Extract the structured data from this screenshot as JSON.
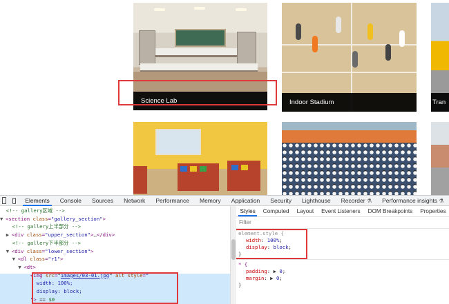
{
  "gallery": {
    "cards": [
      {
        "name": "science-lab-card",
        "caption": "Science Lab"
      },
      {
        "name": "indoor-stadium-card",
        "caption": "Indoor Stadium"
      },
      {
        "name": "transport-card",
        "caption": "Tran"
      }
    ]
  },
  "devtools": {
    "tabs": [
      "Elements",
      "Console",
      "Sources",
      "Network",
      "Performance",
      "Memory",
      "Application",
      "Security",
      "Lighthouse",
      "Recorder",
      "Performance insights"
    ],
    "active_tab": "Elements",
    "flask_icon": "flask-icon",
    "elements": {
      "lines": [
        {
          "indent": "  ",
          "parts": [
            {
              "c": "cmt",
              "t": "<!-- gallery区域 -->"
            }
          ]
        },
        {
          "indent": "",
          "tri": "▼",
          "parts": [
            {
              "c": "tag",
              "t": "<section "
            },
            {
              "c": "attr",
              "t": "class"
            },
            {
              "c": "tag",
              "t": "="
            },
            {
              "c": "val",
              "t": "\"gallery_section\""
            },
            {
              "c": "tag",
              "t": ">"
            }
          ]
        },
        {
          "indent": "    ",
          "parts": [
            {
              "c": "cmt",
              "t": "<!-- gallery上半部分 -->"
            }
          ]
        },
        {
          "indent": "  ",
          "tri": "▶",
          "parts": [
            {
              "c": "tag",
              "t": "<div "
            },
            {
              "c": "attr",
              "t": "class"
            },
            {
              "c": "tag",
              "t": "="
            },
            {
              "c": "val",
              "t": "\"upper_section\""
            },
            {
              "c": "tag",
              "t": ">"
            },
            {
              "c": "plain",
              "t": "…"
            },
            {
              "c": "tag",
              "t": "</div>"
            }
          ]
        },
        {
          "indent": "    ",
          "parts": [
            {
              "c": "cmt",
              "t": "<!-- gallery下半部分 -->"
            }
          ]
        },
        {
          "indent": "  ",
          "tri": "▼",
          "parts": [
            {
              "c": "tag",
              "t": "<div "
            },
            {
              "c": "attr",
              "t": "class"
            },
            {
              "c": "tag",
              "t": "="
            },
            {
              "c": "val",
              "t": "\"lower_section\""
            },
            {
              "c": "tag",
              "t": ">"
            }
          ]
        },
        {
          "indent": "    ",
          "tri": "▼",
          "parts": [
            {
              "c": "tag",
              "t": "<dl "
            },
            {
              "c": "attr",
              "t": "class"
            },
            {
              "c": "tag",
              "t": "="
            },
            {
              "c": "val",
              "t": "\"r1\""
            },
            {
              "c": "tag",
              "t": ">"
            }
          ]
        },
        {
          "indent": "      ",
          "tri": "▼",
          "parts": [
            {
              "c": "tag",
              "t": "<dt>"
            }
          ]
        },
        {
          "indent": "          ",
          "parts": [
            {
              "c": "tag",
              "t": "<img "
            },
            {
              "c": "attr",
              "t": "src"
            },
            {
              "c": "tag",
              "t": "="
            },
            {
              "c": "plain",
              "t": "\""
            },
            {
              "c": "link",
              "t": "images/03-01.jpg"
            },
            {
              "c": "plain",
              "t": "\" "
            },
            {
              "c": "attr",
              "t": "alt style"
            },
            {
              "c": "tag",
              "t": "="
            },
            {
              "c": "val",
              "t": "\""
            }
          ]
        },
        {
          "indent": "            ",
          "parts": [
            {
              "c": "val",
              "t": "width: 100%;"
            }
          ]
        },
        {
          "indent": "            ",
          "parts": [
            {
              "c": "val",
              "t": "display: block;"
            }
          ]
        },
        {
          "indent": "          ",
          "parts": [
            {
              "c": "val",
              "t": "\""
            },
            {
              "c": "tag",
              "t": ">"
            },
            {
              "c": "plain",
              "t": " == "
            },
            {
              "c": "cmt",
              "t": "$0"
            }
          ]
        }
      ]
    },
    "styles": {
      "subtabs": [
        "Styles",
        "Computed",
        "Layout",
        "Event Listeners",
        "DOM Breakpoints",
        "Properties"
      ],
      "active_subtab": "Styles",
      "filter_placeholder": "Filter",
      "element_style": {
        "selector": "element.style {",
        "props": [
          {
            "name": "width",
            "value": "100%"
          },
          {
            "name": "display",
            "value": "block"
          }
        ],
        "close": "}"
      },
      "universal": {
        "selector": "* {",
        "props": [
          {
            "name": "padding",
            "value": "0"
          },
          {
            "name": "margin",
            "value": "0"
          }
        ],
        "close": "}"
      }
    }
  }
}
